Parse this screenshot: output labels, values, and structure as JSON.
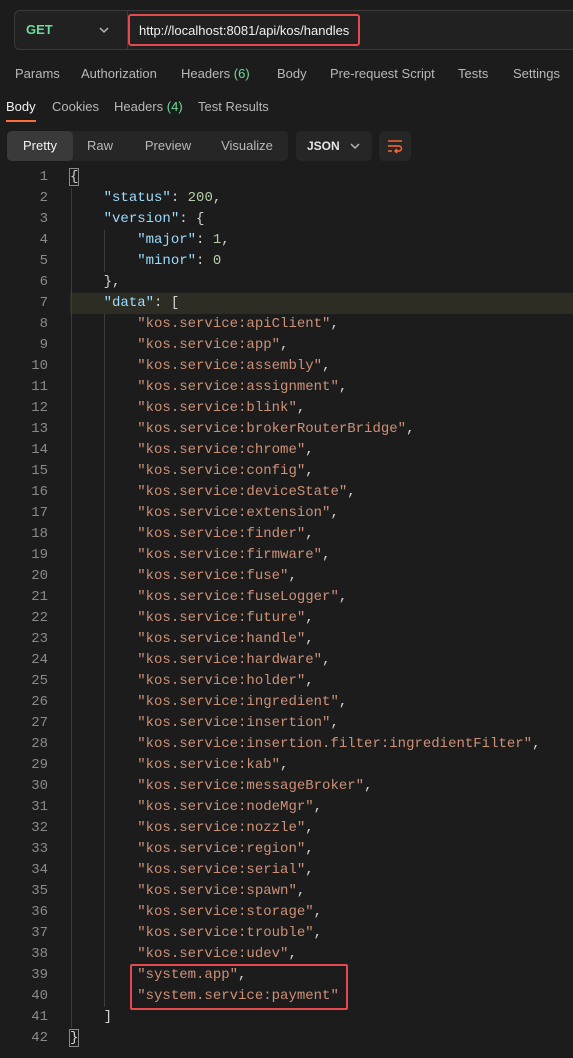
{
  "request": {
    "method": "GET",
    "url": "http://localhost:8081/api/kos/handles"
  },
  "request_tabs": [
    {
      "label": "Params"
    },
    {
      "label": "Authorization"
    },
    {
      "label": "Headers",
      "count": "(6)"
    },
    {
      "label": "Body"
    },
    {
      "label": "Pre-request Script"
    },
    {
      "label": "Tests"
    },
    {
      "label": "Settings"
    }
  ],
  "response_tabs": [
    {
      "label": "Body"
    },
    {
      "label": "Cookies"
    },
    {
      "label": "Headers",
      "count": "(4)"
    },
    {
      "label": "Test Results"
    }
  ],
  "view_modes": [
    "Pretty",
    "Raw",
    "Preview",
    "Visualize"
  ],
  "format": "JSON",
  "icons": {
    "method_dropdown": "chevron-down-icon",
    "format_dropdown": "chevron-down-icon",
    "wrap": "wrap-lines-icon"
  },
  "colors": {
    "method": "#6bdd9a",
    "accent": "#ff6c37",
    "highlight_border": "#e5484d"
  },
  "code_lines": [
    "{",
    "    \"status\": 200,",
    "    \"version\": {",
    "        \"major\": 1,",
    "        \"minor\": 0",
    "    },",
    "    \"data\": [",
    "        \"kos.service:apiClient\",",
    "        \"kos.service:app\",",
    "        \"kos.service:assembly\",",
    "        \"kos.service:assignment\",",
    "        \"kos.service:blink\",",
    "        \"kos.service:brokerRouterBridge\",",
    "        \"kos.service:chrome\",",
    "        \"kos.service:config\",",
    "        \"kos.service:deviceState\",",
    "        \"kos.service:extension\",",
    "        \"kos.service:finder\",",
    "        \"kos.service:firmware\",",
    "        \"kos.service:fuse\",",
    "        \"kos.service:fuseLogger\",",
    "        \"kos.service:future\",",
    "        \"kos.service:handle\",",
    "        \"kos.service:hardware\",",
    "        \"kos.service:holder\",",
    "        \"kos.service:ingredient\",",
    "        \"kos.service:insertion\",",
    "        \"kos.service:insertion.filter:ingredientFilter\",",
    "        \"kos.service:kab\",",
    "        \"kos.service:messageBroker\",",
    "        \"kos.service:nodeMgr\",",
    "        \"kos.service:nozzle\",",
    "        \"kos.service:region\",",
    "        \"kos.service:serial\",",
    "        \"kos.service:spawn\",",
    "        \"kos.service:storage\",",
    "        \"kos.service:trouble\",",
    "        \"kos.service:udev\",",
    "        \"system.app\",",
    "        \"system.service:payment\"",
    "    ]",
    "}"
  ]
}
